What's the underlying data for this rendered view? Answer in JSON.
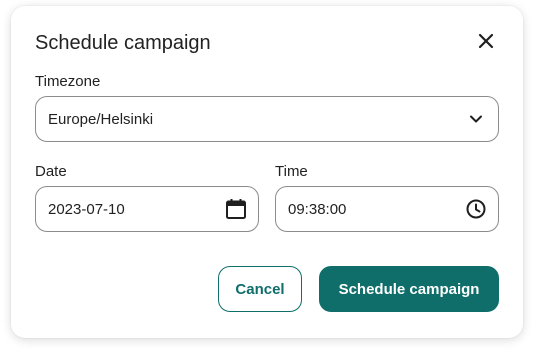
{
  "dialog": {
    "title": "Schedule campaign",
    "close_icon": "close-icon"
  },
  "timezone": {
    "label": "Timezone",
    "value": "Europe/Helsinki",
    "icon": "chevron-down-icon"
  },
  "date": {
    "label": "Date",
    "value": "2023-07-10",
    "icon": "calendar-icon"
  },
  "time": {
    "label": "Time",
    "value": "09:38:00",
    "icon": "clock-icon"
  },
  "actions": {
    "cancel_label": "Cancel",
    "submit_label": "Schedule campaign"
  },
  "colors": {
    "accent": "#0f6e6a",
    "border": "#8c8c8c",
    "text": "#222222"
  }
}
